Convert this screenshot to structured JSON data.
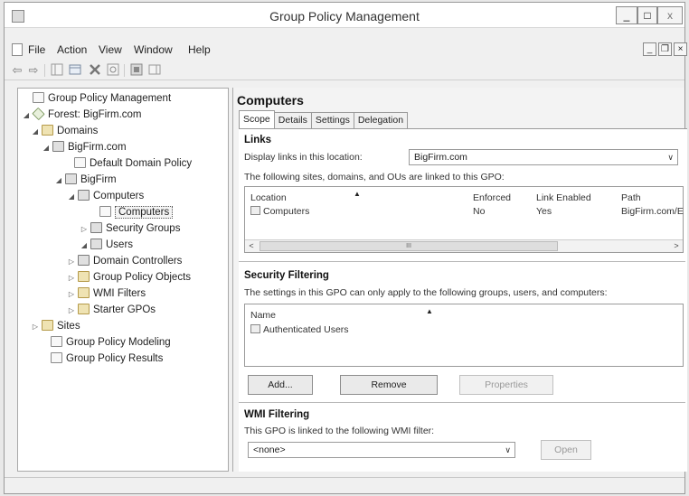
{
  "window": {
    "title": "Group Policy Management",
    "controls": {
      "minimize": "_",
      "maximize": "□",
      "close": "x"
    }
  },
  "menu": {
    "items": [
      "File",
      "Action",
      "View",
      "Window",
      "Help"
    ],
    "mdi_controls": {
      "minimize": "_",
      "restore": "❐",
      "close": "×"
    }
  },
  "toolbar": {
    "back_icon": "⇦",
    "forward_icon": "⇨",
    "icons": [
      "show-hide-tree-icon",
      "console-icon",
      "delete-icon",
      "refresh-icon",
      "help-icon",
      "show-action-pane-icon"
    ]
  },
  "tree": [
    {
      "label": "Group Policy Management",
      "icon": "gpm",
      "expander": ""
    },
    {
      "label": "Forest: BigFirm.com",
      "icon": "forest",
      "expander": "◢"
    },
    {
      "label": "Domains",
      "icon": "folder",
      "expander": "◢"
    },
    {
      "label": "BigFirm.com",
      "icon": "domain",
      "expander": "◢"
    },
    {
      "label": "Default Domain Policy",
      "icon": "gpo",
      "expander": ""
    },
    {
      "label": "BigFirm",
      "icon": "ou",
      "expander": "◢"
    },
    {
      "label": "Computers",
      "icon": "ou",
      "expander": "◢"
    },
    {
      "label": "Computers",
      "icon": "gpo",
      "expander": "",
      "selected": true
    },
    {
      "label": "Security Groups",
      "icon": "ou",
      "expander": "▷"
    },
    {
      "label": "Users",
      "icon": "ou",
      "expander": "◢"
    },
    {
      "label": "Domain Controllers",
      "icon": "ou",
      "expander": "▷"
    },
    {
      "label": "Group Policy Objects",
      "icon": "folder",
      "expander": "▷"
    },
    {
      "label": "WMI Filters",
      "icon": "folder",
      "expander": "▷"
    },
    {
      "label": "Starter GPOs",
      "icon": "folder",
      "expander": "▷"
    },
    {
      "label": "Sites",
      "icon": "folder",
      "expander": "▷"
    },
    {
      "label": "Group Policy Modeling",
      "icon": "gpo",
      "expander": ""
    },
    {
      "label": "Group Policy Results",
      "icon": "gpo",
      "expander": ""
    }
  ],
  "content": {
    "title": "Computers",
    "tabs": [
      "Scope",
      "Details",
      "Settings",
      "Delegation"
    ],
    "links": {
      "heading": "Links",
      "display_label": "Display links in this location:",
      "display_value": "BigFirm.com",
      "description": "The following sites, domains, and OUs are linked to this GPO:",
      "columns": [
        "Location",
        "Enforced",
        "Link Enabled",
        "Path"
      ],
      "rows": [
        {
          "location": "Computers",
          "enforced": "No",
          "link_enabled": "Yes",
          "path": "BigFirm.com/E"
        }
      ],
      "scroll_left": "<",
      "scroll_right": ">",
      "scroll_thumb": "III"
    },
    "security": {
      "heading": "Security Filtering",
      "description": "The settings in this GPO can only apply to the following groups, users, and computers:",
      "column": "Name",
      "rows": [
        "Authenticated Users"
      ],
      "buttons": {
        "add": "Add...",
        "remove": "Remove",
        "properties": "Properties"
      }
    },
    "wmi": {
      "heading": "WMI Filtering",
      "description": "This GPO is linked to the following WMI filter:",
      "value": "<none>",
      "open_button": "Open"
    }
  }
}
